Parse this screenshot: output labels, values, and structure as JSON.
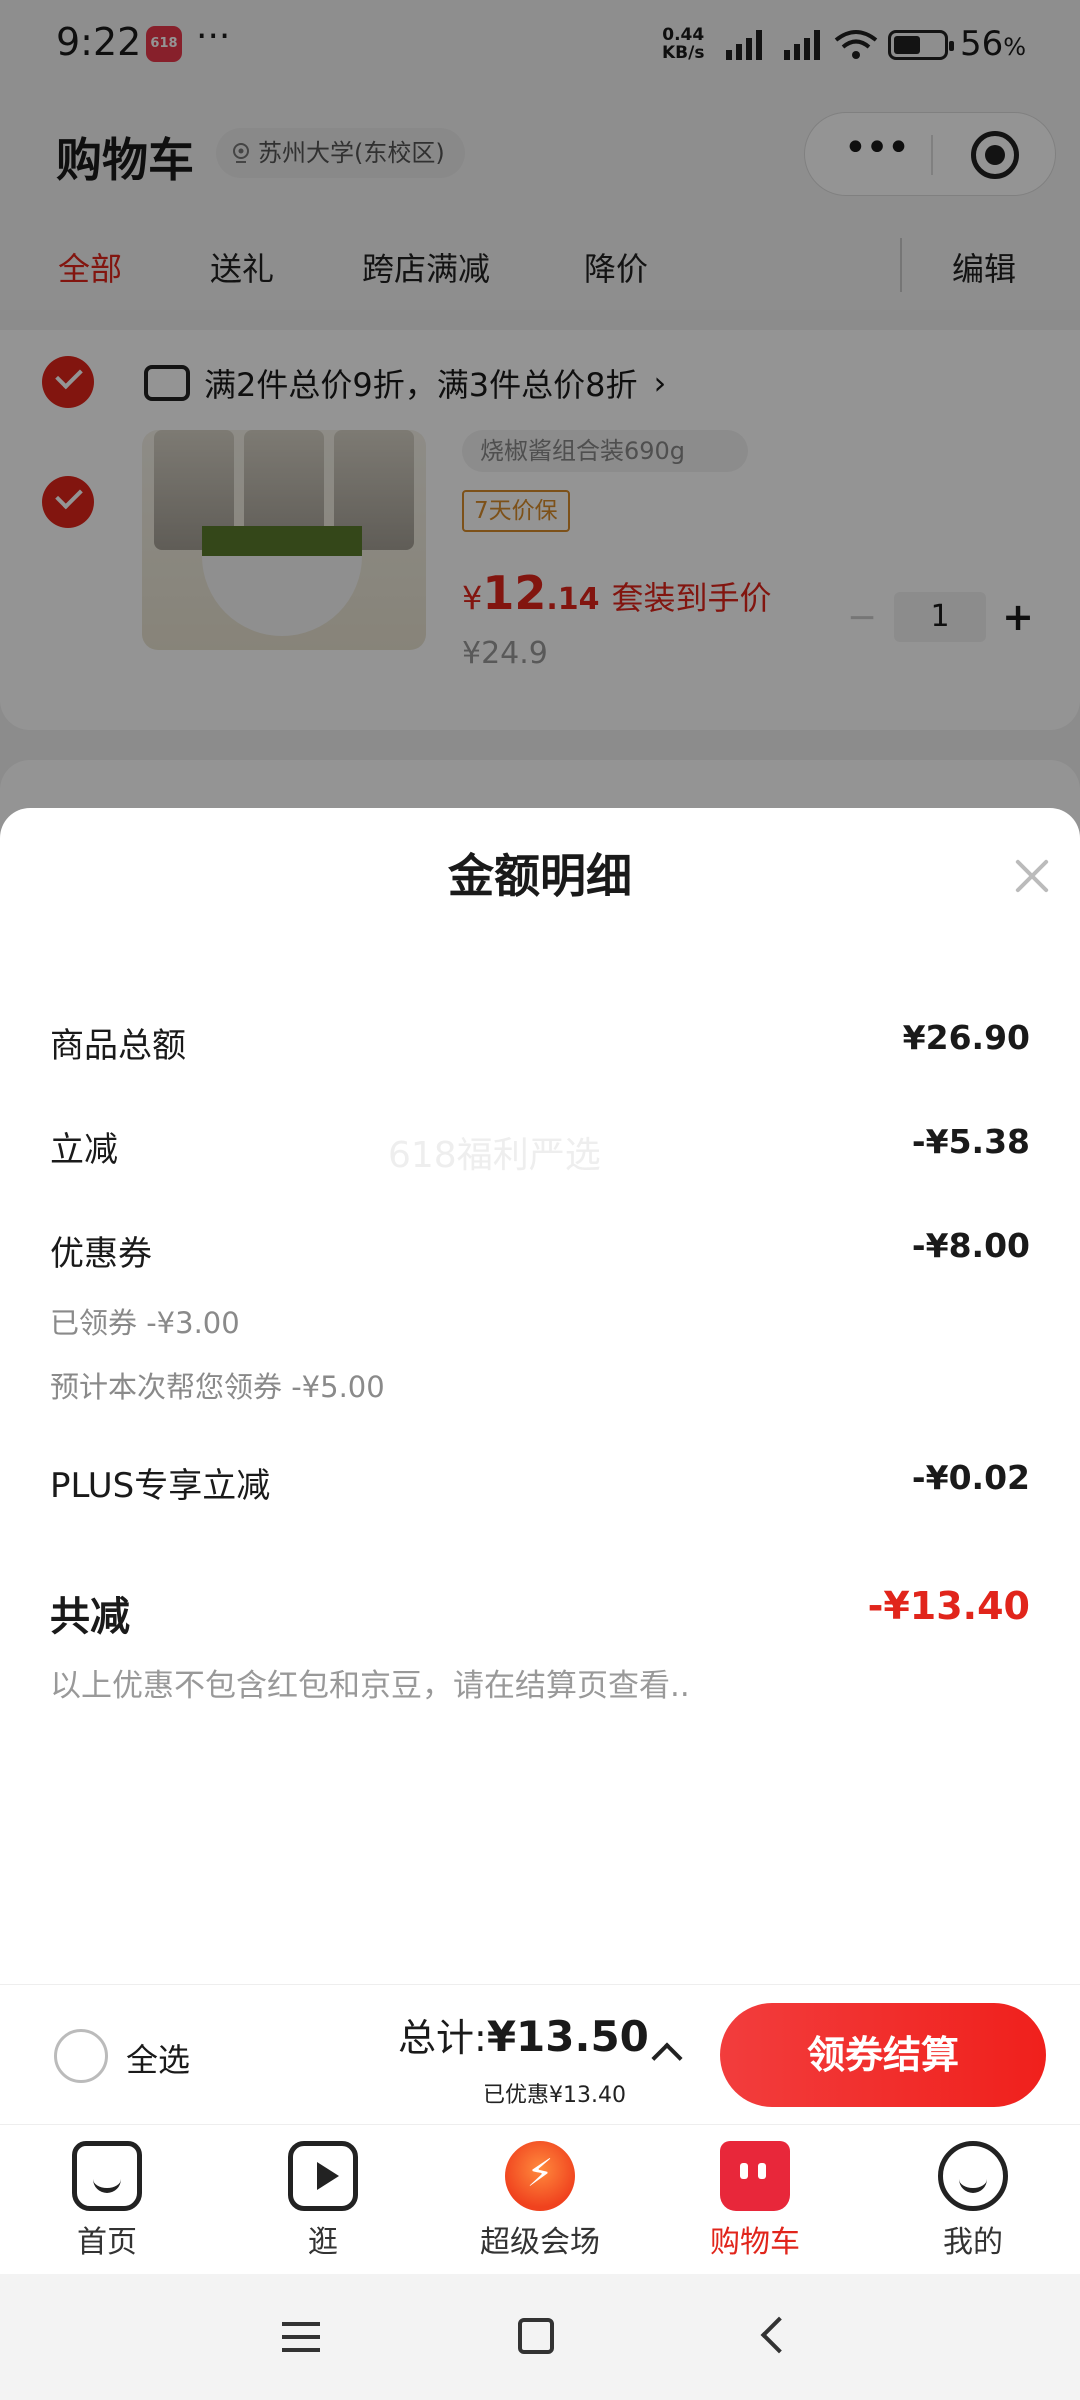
{
  "status_bar": {
    "time": "9:22",
    "app_badge": "618",
    "more": "···",
    "net_speed": "0.44",
    "net_unit": "KB/s",
    "battery_pct": "56",
    "battery_unit": "%"
  },
  "header": {
    "title": "购物车",
    "address": "苏州大学(东校区)"
  },
  "tabs": [
    {
      "label": "全部",
      "active": true
    },
    {
      "label": "送礼"
    },
    {
      "label": "跨店满减"
    },
    {
      "label": "降价"
    }
  ],
  "edit_label": "编辑",
  "cart": {
    "promo": "满2件总价9折，满3件总价8折",
    "promo_arrow": "›",
    "product": {
      "spec": "烧椒酱组合装690g",
      "tag": "7天价保",
      "price_symbol": "¥",
      "price_int": "12",
      "price_dec": ".14",
      "price_desc": "套装到手价",
      "orig_price": "¥24.9",
      "qty": "1",
      "minus": "−",
      "plus": "+"
    }
  },
  "sheet": {
    "title": "金额明细",
    "watermark": "618福利严选",
    "rows": [
      {
        "label": "商品总额",
        "value": "¥26.90"
      },
      {
        "label": "立减",
        "value": "-¥5.38"
      },
      {
        "label": "优惠券",
        "value": "-¥8.00"
      },
      {
        "label": "PLUS专享立减",
        "value": "-¥0.02"
      }
    ],
    "coupon_claimed": "已领券 -¥3.00",
    "coupon_expected": "预计本次帮您领券 -¥5.00",
    "total_label": "共减",
    "total_value": "-¥13.40",
    "note": "以上优惠不包含红包和京豆，请在结算页查看.."
  },
  "checkout": {
    "select_all": "全选",
    "total_prefix": "总计:",
    "total_amount": "¥13.50",
    "saved": "已优惠¥13.40",
    "pay_button": "领券结算"
  },
  "tabbar": [
    {
      "label": "首页",
      "icon": "home-icon"
    },
    {
      "label": "逛",
      "icon": "video-icon"
    },
    {
      "label": "超级会场",
      "icon": "super-venue-icon"
    },
    {
      "label": "购物车",
      "icon": "cart-icon",
      "active": true
    },
    {
      "label": "我的",
      "icon": "smile-icon"
    }
  ],
  "colors": {
    "accent": "#e1251b",
    "coupon_tag": "#d88c2b",
    "overlay": "rgba(0,0,0,0.42)"
  }
}
